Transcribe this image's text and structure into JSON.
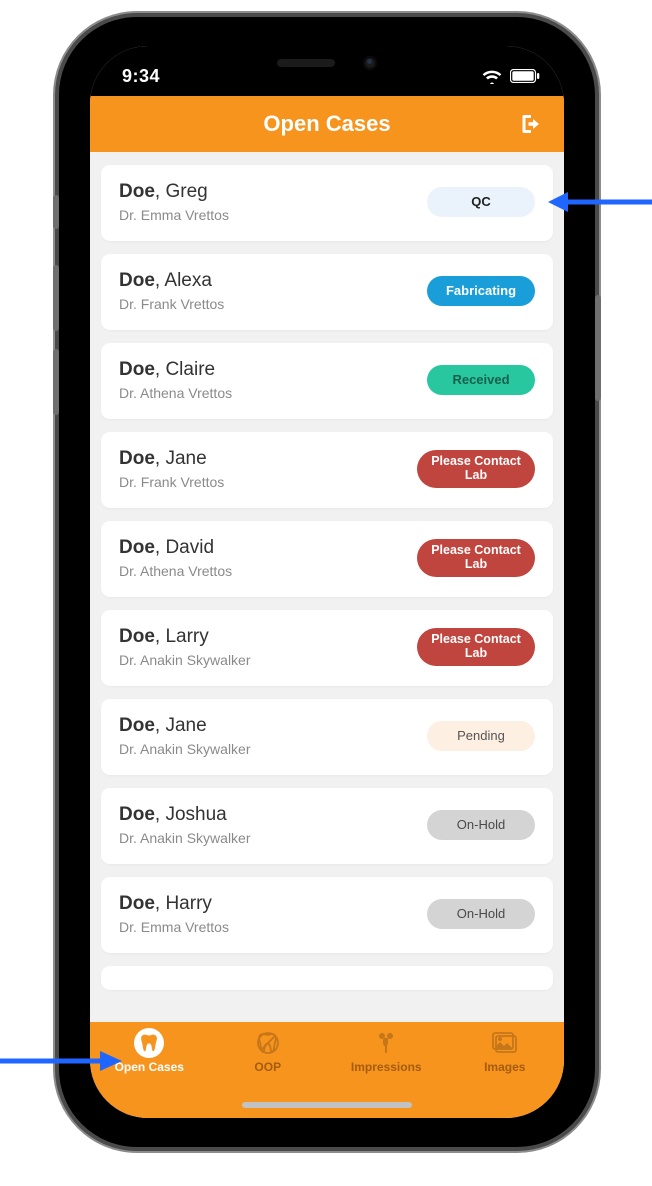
{
  "status_bar": {
    "time": "9:34"
  },
  "header": {
    "title": "Open Cases"
  },
  "cases": [
    {
      "last": "Doe",
      "first": "Greg",
      "doctor": "Dr. Emma Vrettos",
      "status": "QC",
      "variant": "b-qc"
    },
    {
      "last": "Doe",
      "first": "Alexa",
      "doctor": "Dr. Frank Vrettos",
      "status": "Fabricating",
      "variant": "b-fab"
    },
    {
      "last": "Doe",
      "first": "Claire",
      "doctor": "Dr. Athena Vrettos",
      "status": "Received",
      "variant": "b-recv"
    },
    {
      "last": "Doe",
      "first": "Jane",
      "doctor": "Dr. Frank Vrettos",
      "status": "Please Contact\nLab",
      "variant": "b-contact"
    },
    {
      "last": "Doe",
      "first": "David",
      "doctor": "Dr. Athena Vrettos",
      "status": "Please Contact\nLab",
      "variant": "b-contact"
    },
    {
      "last": "Doe",
      "first": "Larry",
      "doctor": "Dr. Anakin Skywalker",
      "status": "Please Contact\nLab",
      "variant": "b-contact"
    },
    {
      "last": "Doe",
      "first": "Jane",
      "doctor": "Dr. Anakin Skywalker",
      "status": "Pending",
      "variant": "b-pend"
    },
    {
      "last": "Doe",
      "first": "Joshua",
      "doctor": "Dr. Anakin Skywalker",
      "status": "On-Hold",
      "variant": "b-hold"
    },
    {
      "last": "Doe",
      "first": "Harry",
      "doctor": "Dr. Emma Vrettos",
      "status": "On-Hold",
      "variant": "b-hold"
    }
  ],
  "tabs": [
    {
      "label": "Open Cases",
      "active": true
    },
    {
      "label": "OOP",
      "active": false
    },
    {
      "label": "Impressions",
      "active": false
    },
    {
      "label": "Images",
      "active": false
    }
  ]
}
